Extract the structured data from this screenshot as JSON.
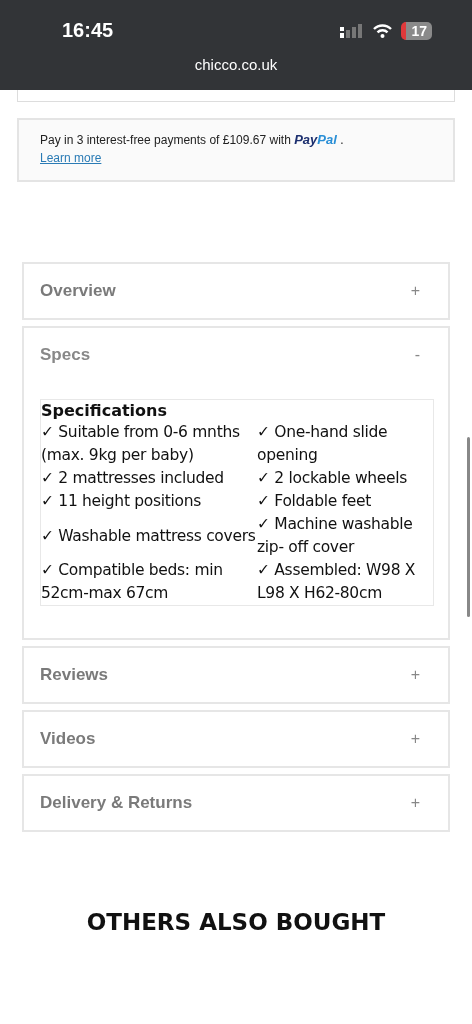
{
  "status_bar": {
    "time": "16:45",
    "battery": "17",
    "url": "chicco.co.uk"
  },
  "payment": {
    "message": "Pay in 3 interest-free payments of £109.67 with",
    "logo_parts": [
      "Pay",
      "Pal"
    ],
    "end": ".",
    "link": "Learn more"
  },
  "accordion": [
    {
      "title": "Overview",
      "toggle": "+",
      "expanded": false
    },
    {
      "title": "Specs",
      "toggle": "-",
      "expanded": true,
      "heading": "Specifications",
      "rows": [
        [
          "✓ Suitable from 0-6 mnths (max. 9kg per baby)",
          "✓ One-hand slide opening"
        ],
        [
          "✓ 2 mattresses included",
          "✓ 2 lockable wheels"
        ],
        [
          "✓ 11 height positions",
          "✓ Foldable feet"
        ],
        [
          "✓ Washable mattress covers",
          "✓ Machine washable zip- off cover"
        ],
        [
          "✓ Compatible beds: min 52cm-max 67cm",
          "✓ Assembled: W98 X L98 X H62-80cm"
        ]
      ]
    },
    {
      "title": "Reviews",
      "toggle": "+",
      "expanded": false
    },
    {
      "title": "Videos",
      "toggle": "+",
      "expanded": false
    },
    {
      "title": "Delivery & Returns",
      "toggle": "+",
      "expanded": false
    }
  ],
  "section_title": "OTHERS ALSO BOUGHT"
}
